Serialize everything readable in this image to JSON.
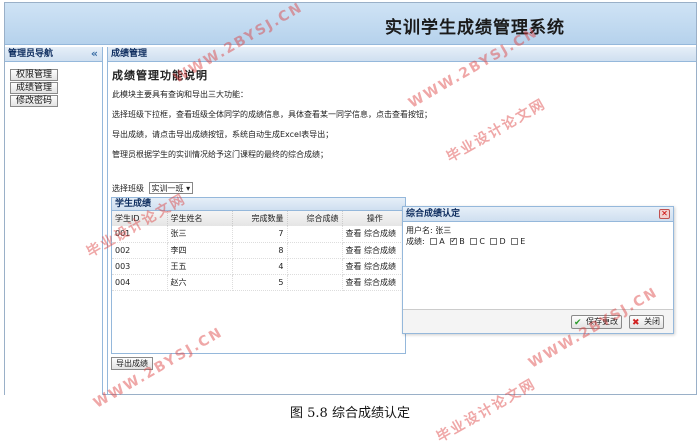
{
  "header": {
    "title": "实训学生成绩管理系统"
  },
  "sidebar": {
    "title": "管理员导航",
    "collapse_glyph": "«",
    "items": [
      {
        "label": "权限管理"
      },
      {
        "label": "成绩管理"
      },
      {
        "label": "修改密码"
      }
    ]
  },
  "main": {
    "panel_title": "成绩管理",
    "heading": "成绩管理功能说明",
    "desc": [
      "此模块主要具有查询和导出三大功能：",
      "选择班级下拉框，查看班级全体同学的成绩信息，具体查看某一同学信息，点击查看按钮；",
      "导出成绩，请点击导出成绩按钮，系统自动生成Excel表导出；",
      "管理员根据学生的实训情况给予这门课程的最终的综合成绩；"
    ],
    "class_select_label": "选择班级",
    "class_select_value": "实训一班",
    "grid_title": "学生成绩",
    "columns": [
      "学生ID",
      "学生姓名",
      "完成数量",
      "综合成绩",
      "操作"
    ],
    "rows": [
      {
        "id": "001",
        "name": "张三",
        "count": "7",
        "score": "",
        "view": "查看",
        "grade": "综合成绩"
      },
      {
        "id": "002",
        "name": "李四",
        "count": "8",
        "score": "",
        "view": "查看",
        "grade": "综合成绩"
      },
      {
        "id": "003",
        "name": "王五",
        "count": "4",
        "score": "",
        "view": "查看",
        "grade": "综合成绩"
      },
      {
        "id": "004",
        "name": "赵六",
        "count": "5",
        "score": "",
        "view": "查看",
        "grade": "综合成绩"
      }
    ],
    "export_label": "导出成绩"
  },
  "dialog": {
    "title": "综合成绩认定",
    "user_label": "用户名: 张三",
    "grade_label": "成绩:",
    "options": [
      {
        "label": "A",
        "checked": false
      },
      {
        "label": "B",
        "checked": true
      },
      {
        "label": "C",
        "checked": false
      },
      {
        "label": "D",
        "checked": false
      },
      {
        "label": "E",
        "checked": false
      }
    ],
    "save_label": "保存更改",
    "close_label": "关闭"
  },
  "caption": "图 5.8  综合成绩认定",
  "watermarks": [
    "WWW.2BYSJ.CN",
    "毕业设计论文网"
  ]
}
